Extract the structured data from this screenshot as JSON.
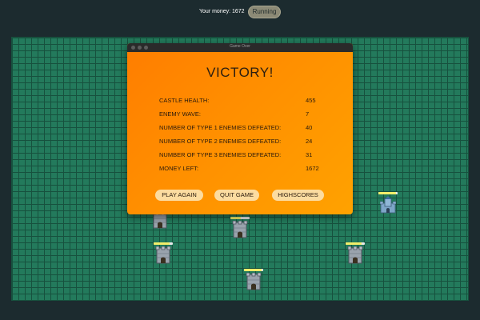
{
  "header": {
    "money_text": "Your money: 1672",
    "status_label": "Running"
  },
  "dialog": {
    "window_title": "Game Over",
    "heading": "VICTORY!",
    "stats": [
      {
        "label": "CASTLE HEALTH:",
        "value": "455"
      },
      {
        "label": "ENEMY WAVE:",
        "value": "7"
      },
      {
        "label": "NUMBER OF TYPE 1 ENEMIES DEFEATED:",
        "value": "40"
      },
      {
        "label": "NUMBER OF TYPE 2 ENEMIES DEFEATED:",
        "value": "24"
      },
      {
        "label": "NUMBER OF TYPE 3 ENEMIES DEFEATED:",
        "value": "31"
      },
      {
        "label": "MONEY LEFT:",
        "value": "1672"
      }
    ],
    "buttons": {
      "play_again": "PLAY AGAIN",
      "quit_game": "QUIT GAME",
      "highscores": "HIGHSCORES"
    }
  },
  "colors": {
    "board_green": "#237a5c",
    "grid_line": "#17513e",
    "dialog_orange": "#ff8f00",
    "button_cream": "#fcdca0",
    "health_bar": "#f2ee6a"
  },
  "towers": [
    {
      "kind": "stone-tower",
      "health_fraction": 0.85
    },
    {
      "kind": "stone-tower",
      "health_fraction": 0.55
    },
    {
      "kind": "stone-tower",
      "health_fraction": 0.85
    },
    {
      "kind": "stone-tower",
      "health_fraction": 0.85
    },
    {
      "kind": "stone-tower",
      "health_fraction": 0.9
    },
    {
      "kind": "blue-castle",
      "health_fraction": 0.9
    }
  ]
}
